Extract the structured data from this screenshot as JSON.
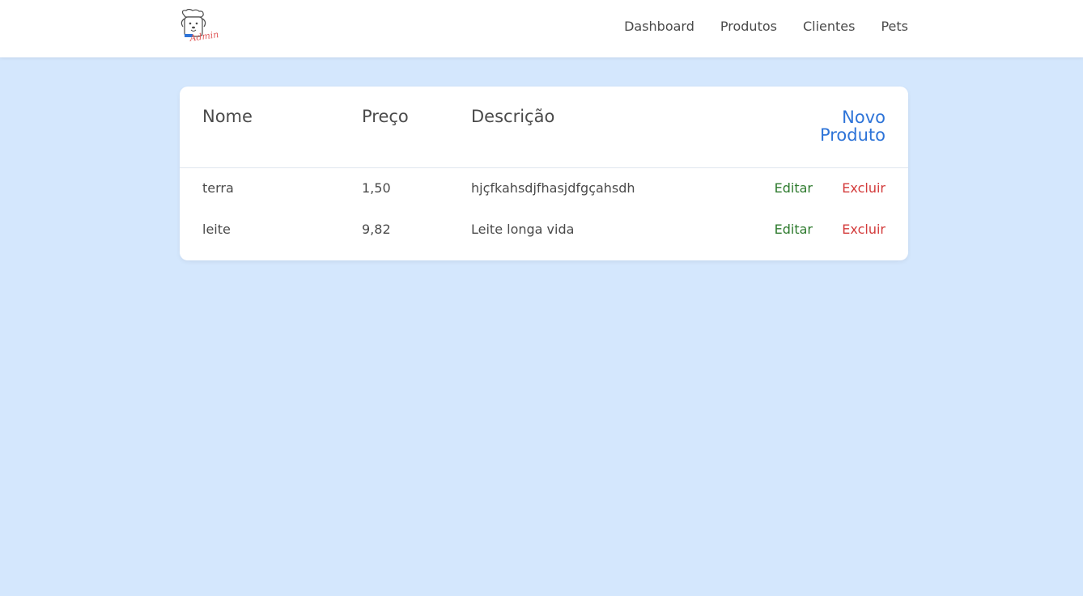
{
  "header": {
    "logo_icon": "dog-chef-admin-logo",
    "logo_text": "Admin",
    "nav": [
      {
        "label": "Dashboard"
      },
      {
        "label": "Produtos"
      },
      {
        "label": "Clientes"
      },
      {
        "label": "Pets"
      }
    ]
  },
  "table": {
    "columns": {
      "nome": "Nome",
      "preco": "Preço",
      "descricao": "Descrição"
    },
    "new_button_line1": "Novo",
    "new_button_line2": "Produto",
    "rows": [
      {
        "nome": "terra",
        "preco": "1,50",
        "descricao": "hjçfkahsdjfhasjdfgçahsdh",
        "edit_label": "Editar",
        "delete_label": "Excluir"
      },
      {
        "nome": "leite",
        "preco": "9,82",
        "descricao": "Leite longa vida",
        "edit_label": "Editar",
        "delete_label": "Excluir"
      }
    ]
  },
  "colors": {
    "background": "#d4e7fd",
    "accent": "#2e74d8",
    "edit": "#2d7a2d",
    "delete": "#d33a3a"
  }
}
